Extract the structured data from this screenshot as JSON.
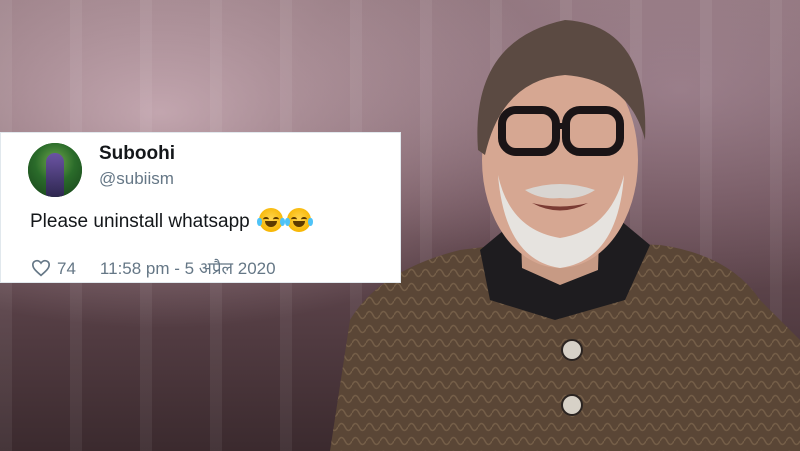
{
  "tweet": {
    "name": "Suboohi",
    "handle": "@subiism",
    "text": "Please uninstall whatsapp",
    "emojis": [
      "face-with-tears-of-joy",
      "face-with-tears-of-joy"
    ],
    "likes": "74",
    "timestamp": "11:58 pm - 5 अप्रैल 2020",
    "colors": {
      "name": "#14171a",
      "secondary": "#657786",
      "card": "#ffffff"
    }
  },
  "background": {
    "description_icon": "man-in-glasses-portrait-photo"
  }
}
